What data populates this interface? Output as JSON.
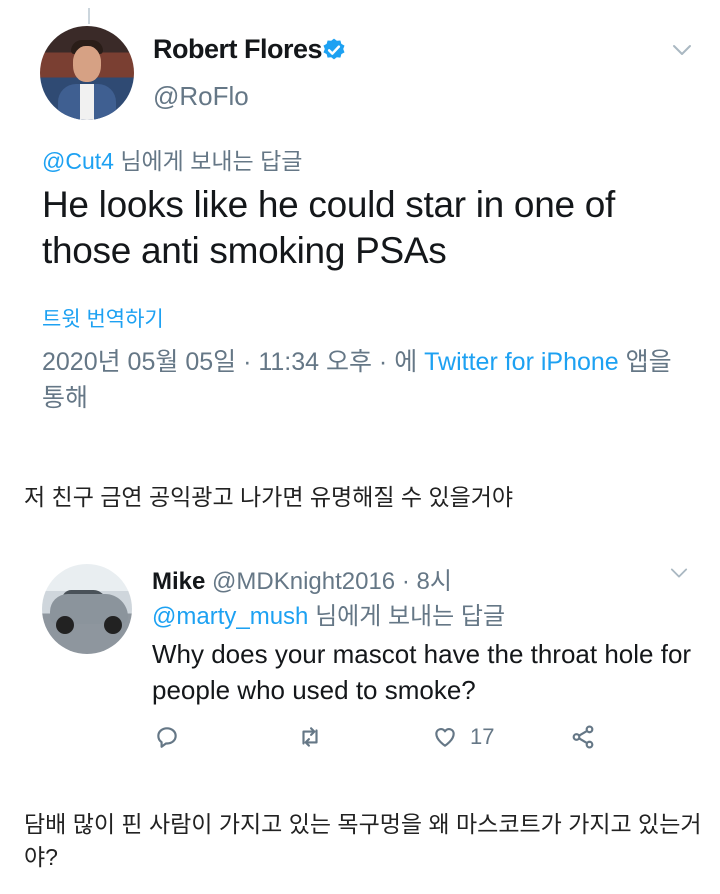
{
  "tweet": {
    "author_name": "Robert Flores",
    "author_handle": "@RoFlo",
    "reply_to_mention": "@Cut4",
    "reply_to_suffix": " 님에게 보내는 답글",
    "text": "He looks like he could star in one of those anti smoking PSAs",
    "translate_label": "트윗 번역하기",
    "timestamp": "2020년 05월 05일 · 11:34 오후 · 에 ",
    "source": "Twitter for iPhone",
    "source_suffix": " 앱을 통해"
  },
  "caption1": "저 친구 금연 공익광고 나가면 유명해질 수 있을거야",
  "reply": {
    "author_name": "Mike",
    "author_handle_time": " @MDKnight2016 · 8시",
    "reply_to_mention": "@marty_mush",
    "reply_to_suffix": " 님에게 보내는 답글",
    "text": "Why does your mascot have the throat hole for people who used to smoke?",
    "like_count": "17"
  },
  "caption2": "담배 많이 핀 사람이 가지고 있는 목구멍을 왜 마스코트가 가지고 있는거야?",
  "colors": {
    "link": "#1da1f2",
    "muted": "#657786",
    "text": "#14171a"
  },
  "icons": [
    "verified-badge-icon",
    "chevron-down-icon",
    "reply-icon",
    "retweet-icon",
    "like-icon",
    "share-icon"
  ]
}
